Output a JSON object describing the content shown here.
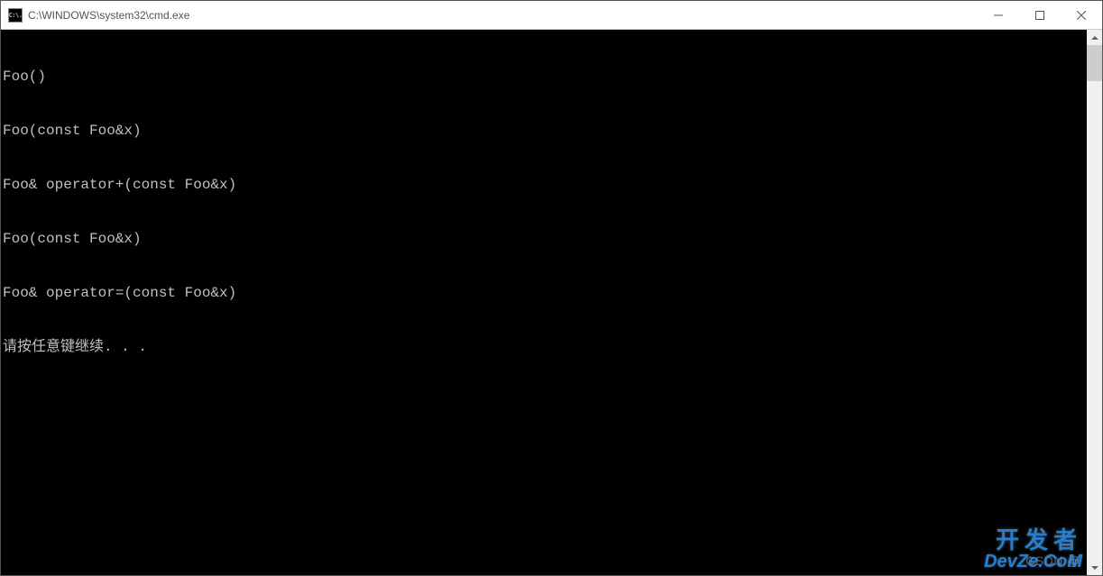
{
  "window": {
    "icon_label": "C:\\.",
    "title": "C:\\WINDOWS\\system32\\cmd.exe"
  },
  "console": {
    "lines": [
      "Foo()",
      "Foo(const Foo&x)",
      "Foo& operator+(const Foo&x)",
      "Foo(const Foo&x)",
      "Foo& operator=(const Foo&x)",
      "请按任意键继续. . ."
    ]
  },
  "watermark": {
    "csdn": "CSDN @",
    "top": "开发者",
    "bottom": "DevZe.CoM"
  }
}
